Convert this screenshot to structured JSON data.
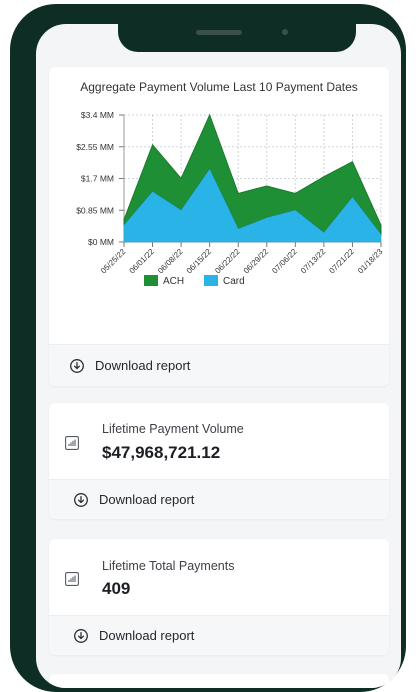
{
  "chart_card": {
    "download_label": "Download report"
  },
  "chart_data": {
    "type": "area",
    "title": "Aggregate Payment Volume Last 10 Payment Dates",
    "x": [
      "05/25/22",
      "06/01/22",
      "06/08/22",
      "06/15/22",
      "06/22/22",
      "06/29/22",
      "07/06/22",
      "07/13/22",
      "07/21/22",
      "01/18/23"
    ],
    "y_ticks": [
      "$0 MM",
      "$0.85 MM",
      "$1.7 MM",
      "$2.55 MM",
      "$3.4 MM"
    ],
    "ylim": [
      0,
      3.4
    ],
    "y_unit": "MM",
    "stacked": true,
    "grid": true,
    "legend_position": "bottom",
    "series": [
      {
        "name": "ACH",
        "color": "#1e8f35",
        "values": [
          0.15,
          1.25,
          0.85,
          1.45,
          0.95,
          0.85,
          0.45,
          1.5,
          0.95,
          0.25
        ]
      },
      {
        "name": "Card",
        "color": "#29b3e6",
        "values": [
          0.45,
          1.35,
          0.85,
          1.95,
          0.35,
          0.65,
          0.85,
          0.25,
          1.2,
          0.2
        ]
      }
    ]
  },
  "volume_card": {
    "label": "Lifetime Payment Volume",
    "value": "$47,968,721.12",
    "download_label": "Download report"
  },
  "payments_card": {
    "label": "Lifetime Total Payments",
    "value": "409",
    "download_label": "Download report"
  }
}
